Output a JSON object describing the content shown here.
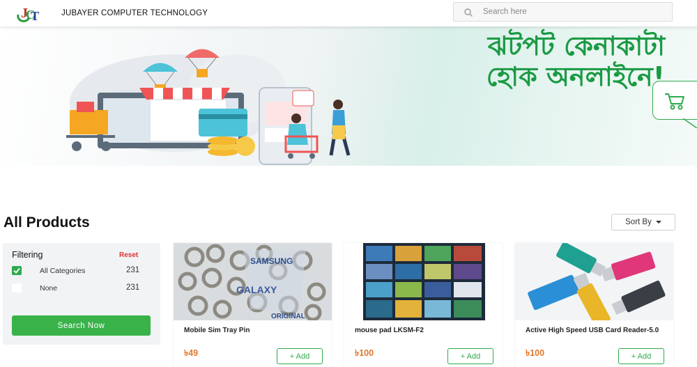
{
  "header": {
    "logo_text": "JCT",
    "brand": "JUBAYER COMPUTER TECHNOLOGY",
    "search_placeholder": "Search here"
  },
  "banner": {
    "line1": "ঝটপট কেনাকাটা",
    "line2": "হোক অনলাইনে!"
  },
  "section": {
    "title": "All Products",
    "sort_label": "Sort By"
  },
  "filter": {
    "title": "Filtering",
    "reset": "Reset",
    "options": [
      {
        "label": "All Categories",
        "count": "231",
        "checked": true
      },
      {
        "label": "None",
        "count": "231",
        "checked": false
      }
    ],
    "button": "Search Now"
  },
  "products": [
    {
      "name": "Mobile Sim Tray Pin",
      "price": "৳49",
      "add": "+ Add"
    },
    {
      "name": "mouse pad LKSM-F2",
      "price": "৳100",
      "add": "+ Add"
    },
    {
      "name": "Active High Speed USB Card Reader-5.0",
      "price": "৳100",
      "add": "+ Add"
    }
  ],
  "colors": {
    "accent": "#2eaa4d",
    "price": "#e3762a",
    "reset": "#e03131",
    "banner_text": "#1a9a43"
  }
}
